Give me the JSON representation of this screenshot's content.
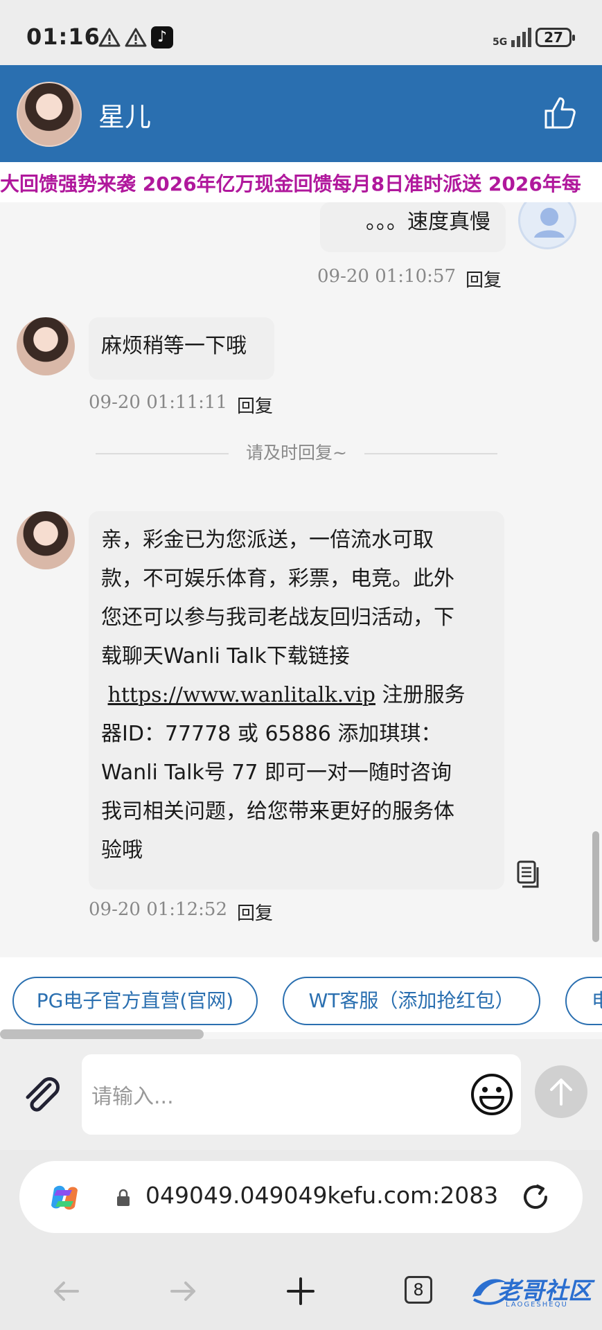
{
  "status_bar": {
    "time": "01:16",
    "network": "5G",
    "battery": "27"
  },
  "header": {
    "name": "星儿",
    "like_icon": "thumbs-up-icon"
  },
  "marquee": {
    "text": "大回馈强势来袭 2026年亿万现金回馈每月8日准时派送 2026年每"
  },
  "messages": [
    {
      "side": "right",
      "text": "。。。速度真慢",
      "time": "09-20 01:10:57",
      "reply": "回复"
    },
    {
      "side": "left",
      "text": "麻烦稍等一下哦",
      "time": "09-20 01:11:11",
      "reply": "回复"
    },
    {
      "side": "left",
      "text_lines": [
        "亲，彩金已为您派送，一倍流水可取",
        "款，不可娱乐体育，彩票，电竞。此外",
        "您还可以参与我司老战友回归活动，下",
        "载聊天Wanli Talk下载链接"
      ],
      "link": "https://www.wanlitalk.vip",
      "text_after_link": " 注册服务",
      "text_lines_2": [
        "器ID：77778 或 65886 添加琪琪：",
        "Wanli Talk号 77 即可一对一随时咨询",
        "我司相关问题，给您带来更好的服务体",
        "验哦"
      ],
      "time": "09-20 01:12:52",
      "reply": "回复"
    }
  ],
  "divider": {
    "text": "请及时回复~"
  },
  "quick_links": [
    "PG电子官方直营(官网)",
    "WT客服（添加抢红包）",
    "电"
  ],
  "input": {
    "placeholder": "请输入..."
  },
  "browser": {
    "url": "049049.049049kefu.com:2083",
    "tab_count": "8"
  },
  "watermark": {
    "text": "老哥社区",
    "sub": "LAOGESHEQU"
  },
  "colors": {
    "header": "#2a6fb0",
    "marquee": "#b0189c",
    "accent": "#2a6fb0"
  }
}
